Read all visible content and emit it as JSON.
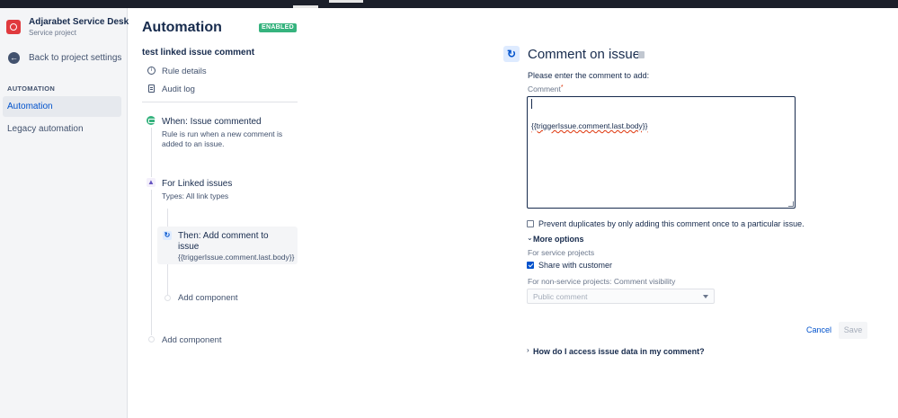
{
  "sidebar": {
    "project_name": "Adjarabet Service Desk",
    "project_type": "Service project",
    "back_label": "Back to project settings",
    "section_header": "AUTOMATION",
    "items": [
      {
        "label": "Automation",
        "active": true
      },
      {
        "label": "Legacy automation",
        "active": false
      }
    ]
  },
  "rule": {
    "page_title": "Automation",
    "status_badge": "ENABLED",
    "name": "test linked issue comment",
    "links": [
      "Rule details",
      "Audit log"
    ],
    "trigger": {
      "title": "When: Issue commented",
      "desc_line1": "Rule is run when a new comment is",
      "desc_line2": "added to an issue."
    },
    "branch": {
      "title": "For Linked issues",
      "desc": "Types: All link types"
    },
    "action": {
      "title_line1": "Then: Add comment to",
      "title_line2": "issue",
      "desc": "{{triggerIssue.comment.last.body}}"
    },
    "add_component_inner": "Add component",
    "add_component_outer": "Add component"
  },
  "panel": {
    "title": "Comment on issue",
    "instruction": "Please enter the comment to add:",
    "comment_label": "Comment",
    "required_mark": "*",
    "comment_value": "{{triggerIssue.comment.last.body}}",
    "prevent_duplicates": "Prevent duplicates by only adding this comment once to a particular issue.",
    "prevent_duplicates_checked": false,
    "more_options": "More options",
    "service_projects_label": "For service projects",
    "share_with_customer": "Share with customer",
    "share_with_customer_checked": true,
    "non_service_label": "For non-service projects: Comment visibility",
    "visibility_placeholder": "Public comment",
    "cancel_label": "Cancel",
    "save_label": "Save",
    "help_link": "How do I access issue data in my comment?"
  },
  "colors": {
    "accent": "#0052cc",
    "enabled_badge": "#36b37e",
    "logo": "#e03a3e",
    "topbar": "#1b1f2a"
  },
  "icons": {
    "back": "arrow-left-icon",
    "rule_details": "info-icon",
    "audit_log": "document-icon",
    "trigger": "comment-trigger-icon",
    "branch": "branch-icon",
    "action": "refresh-icon",
    "delete": "trash-icon"
  }
}
